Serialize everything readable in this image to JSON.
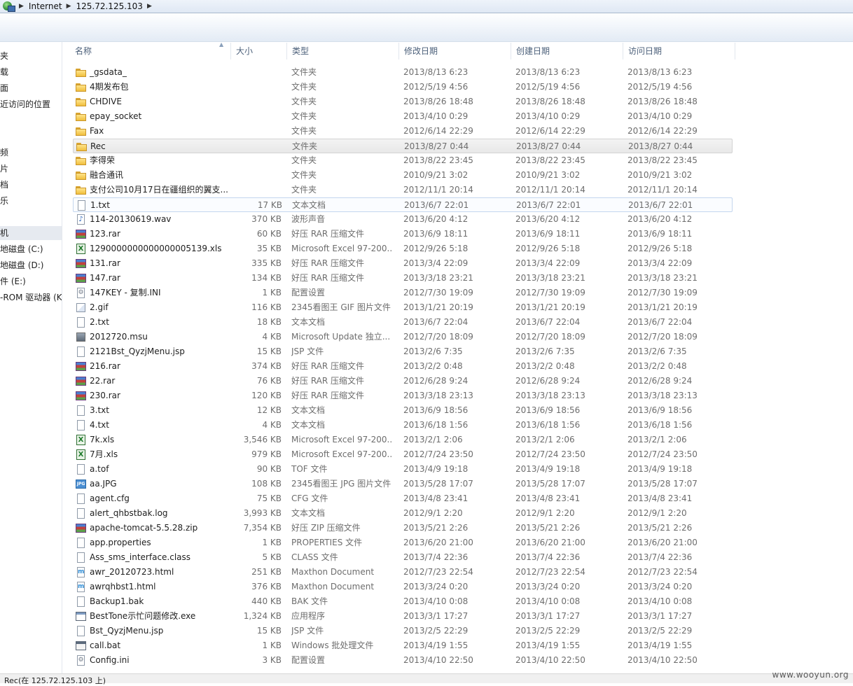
{
  "breadcrumb": {
    "items": [
      "Internet",
      "125.72.125.103"
    ]
  },
  "nav": {
    "items": [
      {
        "label": "夹"
      },
      {
        "label": "载"
      },
      {
        "label": "面"
      },
      {
        "label": "近访问的位置"
      },
      {
        "label": "频"
      },
      {
        "label": "片"
      },
      {
        "label": "档"
      },
      {
        "label": "乐"
      },
      {
        "label": "机"
      },
      {
        "label": "地磁盘 (C:)"
      },
      {
        "label": "地磁盘 (D:)"
      },
      {
        "label": "件 (E:)"
      },
      {
        "label": "-ROM 驱动器 (K"
      }
    ]
  },
  "columns": {
    "name": "名称",
    "size": "大小",
    "type": "类型",
    "modified": "修改日期",
    "created": "创建日期",
    "accessed": "访问日期"
  },
  "files": [
    {
      "icon": "folder-icon",
      "name": "_gsdata_",
      "size": "",
      "type": "文件夹",
      "modified": "2013/8/13 6:23",
      "created": "2013/8/13 6:23",
      "accessed": "2013/8/13 6:23"
    },
    {
      "icon": "folder-icon",
      "name": "4期发布包",
      "size": "",
      "type": "文件夹",
      "modified": "2012/5/19 4:56",
      "created": "2012/5/19 4:56",
      "accessed": "2012/5/19 4:56"
    },
    {
      "icon": "folder-icon",
      "name": "CHDIVE",
      "size": "",
      "type": "文件夹",
      "modified": "2013/8/26 18:48",
      "created": "2013/8/26 18:48",
      "accessed": "2013/8/26 18:48"
    },
    {
      "icon": "folder-icon",
      "name": "epay_socket",
      "size": "",
      "type": "文件夹",
      "modified": "2013/4/10 0:29",
      "created": "2013/4/10 0:29",
      "accessed": "2013/4/10 0:29"
    },
    {
      "icon": "folder-icon",
      "name": "Fax",
      "size": "",
      "type": "文件夹",
      "modified": "2012/6/14 22:29",
      "created": "2012/6/14 22:29",
      "accessed": "2012/6/14 22:29"
    },
    {
      "icon": "folder-icon",
      "name": "Rec",
      "size": "",
      "type": "文件夹",
      "modified": "2013/8/27 0:44",
      "created": "2013/8/27 0:44",
      "accessed": "2013/8/27 0:44"
    },
    {
      "icon": "folder-icon",
      "name": "李得荣",
      "size": "",
      "type": "文件夹",
      "modified": "2013/8/22 23:45",
      "created": "2013/8/22 23:45",
      "accessed": "2013/8/22 23:45"
    },
    {
      "icon": "folder-icon",
      "name": "融合通讯",
      "size": "",
      "type": "文件夹",
      "modified": "2010/9/21 3:02",
      "created": "2010/9/21 3:02",
      "accessed": "2010/9/21 3:02"
    },
    {
      "icon": "folder-icon",
      "name": "支付公司10月17日在疆组织的翼支...",
      "size": "",
      "type": "文件夹",
      "modified": "2012/11/1 20:14",
      "created": "2012/11/1 20:14",
      "accessed": "2012/11/1 20:14"
    },
    {
      "icon": "text-file-icon",
      "name": "1.txt",
      "size": "17 KB",
      "type": "文本文档",
      "modified": "2013/6/7 22:01",
      "created": "2013/6/7 22:01",
      "accessed": "2013/6/7 22:01"
    },
    {
      "icon": "audio-file-icon",
      "name": "114-20130619.wav",
      "size": "370 KB",
      "type": "波形声音",
      "modified": "2013/6/20 4:12",
      "created": "2013/6/20 4:12",
      "accessed": "2013/6/20 4:12"
    },
    {
      "icon": "rar-archive-icon",
      "name": "123.rar",
      "size": "60 KB",
      "type": "好压 RAR 压缩文件",
      "modified": "2013/6/9 18:11",
      "created": "2013/6/9 18:11",
      "accessed": "2013/6/9 18:11"
    },
    {
      "icon": "excel-file-icon",
      "name": "1290000000000000005139.xls",
      "size": "35 KB",
      "type": "Microsoft Excel 97-200...",
      "modified": "2012/9/26 5:18",
      "created": "2012/9/26 5:18",
      "accessed": "2012/9/26 5:18"
    },
    {
      "icon": "rar-archive-icon",
      "name": "131.rar",
      "size": "335 KB",
      "type": "好压 RAR 压缩文件",
      "modified": "2013/3/4 22:09",
      "created": "2013/3/4 22:09",
      "accessed": "2013/3/4 22:09"
    },
    {
      "icon": "rar-archive-icon",
      "name": "147.rar",
      "size": "134 KB",
      "type": "好压 RAR 压缩文件",
      "modified": "2013/3/18 23:21",
      "created": "2013/3/18 23:21",
      "accessed": "2013/3/18 23:21"
    },
    {
      "icon": "config-file-icon",
      "name": "147KEY - 复制.INI",
      "size": "1 KB",
      "type": "配置设置",
      "modified": "2012/7/30 19:09",
      "created": "2012/7/30 19:09",
      "accessed": "2012/7/30 19:09"
    },
    {
      "icon": "gif-image-icon",
      "name": "2.gif",
      "size": "116 KB",
      "type": "2345看图王 GIF 图片文件",
      "modified": "2013/1/21 20:19",
      "created": "2013/1/21 20:19",
      "accessed": "2013/1/21 20:19"
    },
    {
      "icon": "text-file-icon",
      "name": "2.txt",
      "size": "18 KB",
      "type": "文本文档",
      "modified": "2013/6/7 22:04",
      "created": "2013/6/7 22:04",
      "accessed": "2013/6/7 22:04"
    },
    {
      "icon": "update-package-icon",
      "name": "2012720.msu",
      "size": "4 KB",
      "type": "Microsoft Update 独立...",
      "modified": "2012/7/20 18:09",
      "created": "2012/7/20 18:09",
      "accessed": "2012/7/20 18:09"
    },
    {
      "icon": "text-file-icon",
      "name": "2121Bst_QyzjMenu.jsp",
      "size": "15 KB",
      "type": "JSP 文件",
      "modified": "2013/2/6 7:35",
      "created": "2013/2/6 7:35",
      "accessed": "2013/2/6 7:35"
    },
    {
      "icon": "rar-archive-icon",
      "name": "216.rar",
      "size": "374 KB",
      "type": "好压 RAR 压缩文件",
      "modified": "2013/2/2 0:48",
      "created": "2013/2/2 0:48",
      "accessed": "2013/2/2 0:48"
    },
    {
      "icon": "rar-archive-icon",
      "name": "22.rar",
      "size": "76 KB",
      "type": "好压 RAR 压缩文件",
      "modified": "2012/6/28 9:24",
      "created": "2012/6/28 9:24",
      "accessed": "2012/6/28 9:24"
    },
    {
      "icon": "rar-archive-icon",
      "name": "230.rar",
      "size": "120 KB",
      "type": "好压 RAR 压缩文件",
      "modified": "2013/3/18 23:13",
      "created": "2013/3/18 23:13",
      "accessed": "2013/3/18 23:13"
    },
    {
      "icon": "text-file-icon",
      "name": "3.txt",
      "size": "12 KB",
      "type": "文本文档",
      "modified": "2013/6/9 18:56",
      "created": "2013/6/9 18:56",
      "accessed": "2013/6/9 18:56"
    },
    {
      "icon": "text-file-icon",
      "name": "4.txt",
      "size": "4 KB",
      "type": "文本文档",
      "modified": "2013/6/18 1:56",
      "created": "2013/6/18 1:56",
      "accessed": "2013/6/18 1:56"
    },
    {
      "icon": "excel-file-icon",
      "name": "7k.xls",
      "size": "3,546 KB",
      "type": "Microsoft Excel 97-200...",
      "modified": "2013/2/1 2:06",
      "created": "2013/2/1 2:06",
      "accessed": "2013/2/1 2:06"
    },
    {
      "icon": "excel-file-icon",
      "name": "7月.xls",
      "size": "979 KB",
      "type": "Microsoft Excel 97-200...",
      "modified": "2012/7/24 23:50",
      "created": "2012/7/24 23:50",
      "accessed": "2012/7/24 23:50"
    },
    {
      "icon": "text-file-icon",
      "name": "a.tof",
      "size": "90 KB",
      "type": "TOF 文件",
      "modified": "2013/4/9 19:18",
      "created": "2013/4/9 19:18",
      "accessed": "2013/4/9 19:18"
    },
    {
      "icon": "jpg-image-icon",
      "name": "aa.JPG",
      "size": "108 KB",
      "type": "2345看图王 JPG 图片文件",
      "modified": "2013/5/28 17:07",
      "created": "2013/5/28 17:07",
      "accessed": "2013/5/28 17:07"
    },
    {
      "icon": "text-file-icon",
      "name": "agent.cfg",
      "size": "75 KB",
      "type": "CFG 文件",
      "modified": "2013/4/8 23:41",
      "created": "2013/4/8 23:41",
      "accessed": "2013/4/8 23:41"
    },
    {
      "icon": "text-file-icon",
      "name": "alert_qhbstbak.log",
      "size": "3,993 KB",
      "type": "文本文档",
      "modified": "2012/9/1 2:20",
      "created": "2012/9/1 2:20",
      "accessed": "2012/9/1 2:20"
    },
    {
      "icon": "rar-archive-icon",
      "name": "apache-tomcat-5.5.28.zip",
      "size": "7,354 KB",
      "type": "好压 ZIP 压缩文件",
      "modified": "2013/5/21 2:26",
      "created": "2013/5/21 2:26",
      "accessed": "2013/5/21 2:26"
    },
    {
      "icon": "text-file-icon",
      "name": "app.properties",
      "size": "1 KB",
      "type": "PROPERTIES 文件",
      "modified": "2013/6/20 21:00",
      "created": "2013/6/20 21:00",
      "accessed": "2013/6/20 21:00"
    },
    {
      "icon": "text-file-icon",
      "name": "Ass_sms_interface.class",
      "size": "5 KB",
      "type": "CLASS 文件",
      "modified": "2013/7/4 22:36",
      "created": "2013/7/4 22:36",
      "accessed": "2013/7/4 22:36"
    },
    {
      "icon": "html-document-icon",
      "name": "awr_20120723.html",
      "size": "251 KB",
      "type": "Maxthon Document",
      "modified": "2012/7/23 22:54",
      "created": "2012/7/23 22:54",
      "accessed": "2012/7/23 22:54"
    },
    {
      "icon": "html-document-icon",
      "name": "awrqhbst1.html",
      "size": "376 KB",
      "type": "Maxthon Document",
      "modified": "2013/3/24 0:20",
      "created": "2013/3/24 0:20",
      "accessed": "2013/3/24 0:20"
    },
    {
      "icon": "text-file-icon",
      "name": "Backup1.bak",
      "size": "440 KB",
      "type": "BAK 文件",
      "modified": "2013/4/10 0:08",
      "created": "2013/4/10 0:08",
      "accessed": "2013/4/10 0:08"
    },
    {
      "icon": "application-icon",
      "name": "BestTone示忙问题修改.exe",
      "size": "1,324 KB",
      "type": "应用程序",
      "modified": "2013/3/1 17:27",
      "created": "2013/3/1 17:27",
      "accessed": "2013/3/1 17:27"
    },
    {
      "icon": "text-file-icon",
      "name": "Bst_QyzjMenu.jsp",
      "size": "15 KB",
      "type": "JSP 文件",
      "modified": "2013/2/5 22:29",
      "created": "2013/2/5 22:29",
      "accessed": "2013/2/5 22:29"
    },
    {
      "icon": "batch-file-icon",
      "name": "call.bat",
      "size": "1 KB",
      "type": "Windows 批处理文件",
      "modified": "2013/4/19 1:55",
      "created": "2013/4/19 1:55",
      "accessed": "2013/4/19 1:55"
    },
    {
      "icon": "config-file-icon",
      "name": "Config.ini",
      "size": "3 KB",
      "type": "配置设置",
      "modified": "2013/4/10 22:50",
      "created": "2013/4/10 22:50",
      "accessed": "2013/4/10 22:50"
    }
  ],
  "status": {
    "text": "Rec(在 125.72.125.103 上)"
  },
  "watermark": "www.wooyun.org"
}
